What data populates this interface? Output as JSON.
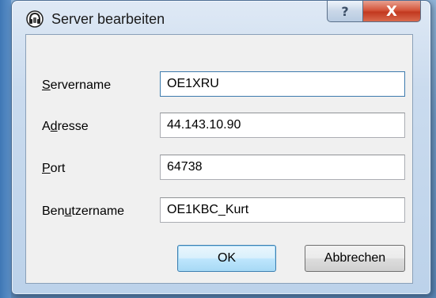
{
  "window": {
    "title": "Server bearbeiten",
    "help_glyph": "?",
    "close_glyph": "X"
  },
  "fields": {
    "servername": {
      "label_before": "",
      "label_underlined": "S",
      "label_after": "ervername",
      "value": "OE1XRU"
    },
    "adresse": {
      "label_before": "A",
      "label_underlined": "d",
      "label_after": "resse",
      "value": "44.143.10.90"
    },
    "port": {
      "label_before": "",
      "label_underlined": "P",
      "label_after": "ort",
      "value": "64738"
    },
    "benutzername": {
      "label_before": "Ben",
      "label_underlined": "u",
      "label_after": "tzername",
      "value": "OE1KBC_Kurt"
    }
  },
  "buttons": {
    "ok_label": "OK",
    "cancel_label": "Abbrechen"
  },
  "icons": {
    "app": "mumble-headset-icon",
    "help": "help-icon",
    "close": "close-icon"
  }
}
